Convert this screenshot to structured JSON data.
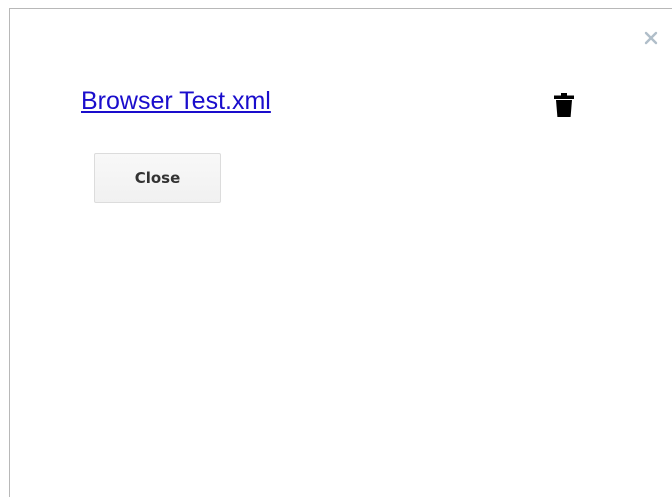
{
  "dialog": {
    "close_icon": "close-x-icon",
    "file": {
      "name": "Browser Test.xml",
      "delete_icon": "trash-icon"
    },
    "close_button_label": "Close"
  },
  "colors": {
    "link": "#1a0dcc",
    "close_x": "#b0bec9",
    "trash": "#000000",
    "button_border": "#dcdcdc"
  }
}
